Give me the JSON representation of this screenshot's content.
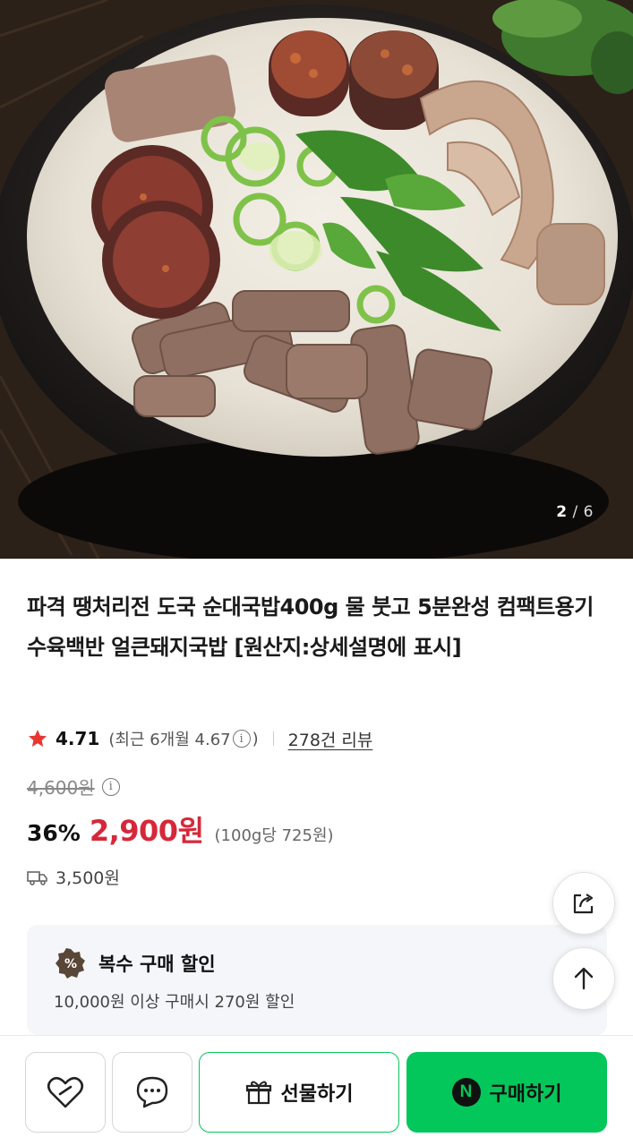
{
  "gallery": {
    "image_alt": "순대국밥",
    "current": "2",
    "separator": "/",
    "total": "6"
  },
  "product": {
    "title": "파격 땡처리전 도국 순대국밥400g 물 붓고 5분완성 컴팩트용기 수육백반 얼큰돼지국밥 [원산지:상세설명에 표시]",
    "rating": "4.71",
    "recent_rating_prefix": "(최근 6개월 4.67",
    "recent_rating_suffix": ")",
    "review_count": "278건 리뷰",
    "original_price": "4,600원",
    "discount": "36%",
    "price": "2,900원",
    "unit_price": "(100g당 725원)",
    "shipping_fee": "3,500원"
  },
  "promo": {
    "badge_symbol": "%",
    "title": "복수 구매 할인",
    "description": "10,000원 이상 구매시 270원 할인"
  },
  "actions": {
    "gift_label": "선물하기",
    "buy_label": "구매하기",
    "buy_logo": "N"
  },
  "icons": {
    "star": "star-icon",
    "info": "info-icon",
    "truck": "truck-icon",
    "share": "share-icon",
    "arrow_up": "arrow-up-icon",
    "heart": "heart-icon",
    "chat": "chat-bubble-icon",
    "gift": "gift-icon"
  },
  "colors": {
    "accent_green": "#03c75a",
    "price_red": "#d6283a",
    "star_red": "#e8362f",
    "promo_bg": "#f4f6fa"
  }
}
